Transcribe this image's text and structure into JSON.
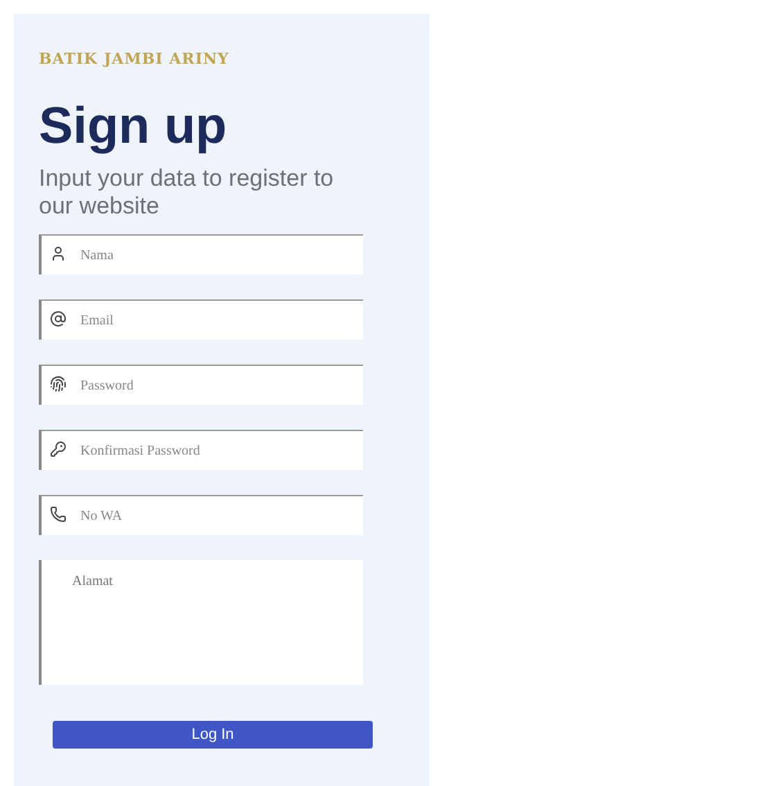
{
  "brand": "BATIK JAMBI ARINY",
  "title": "Sign up",
  "subtitle": "Input your data to register to our website",
  "fields": [
    {
      "kind": "input",
      "placeholder": "Nama"
    },
    {
      "kind": "input",
      "placeholder": "Email"
    },
    {
      "kind": "input",
      "placeholder": "Password"
    },
    {
      "kind": "input",
      "placeholder": "Konfirmasi Password"
    },
    {
      "kind": "input",
      "placeholder": "No WA"
    },
    {
      "kind": "textarea",
      "placeholder": "Alamat"
    }
  ],
  "button": "Log In"
}
